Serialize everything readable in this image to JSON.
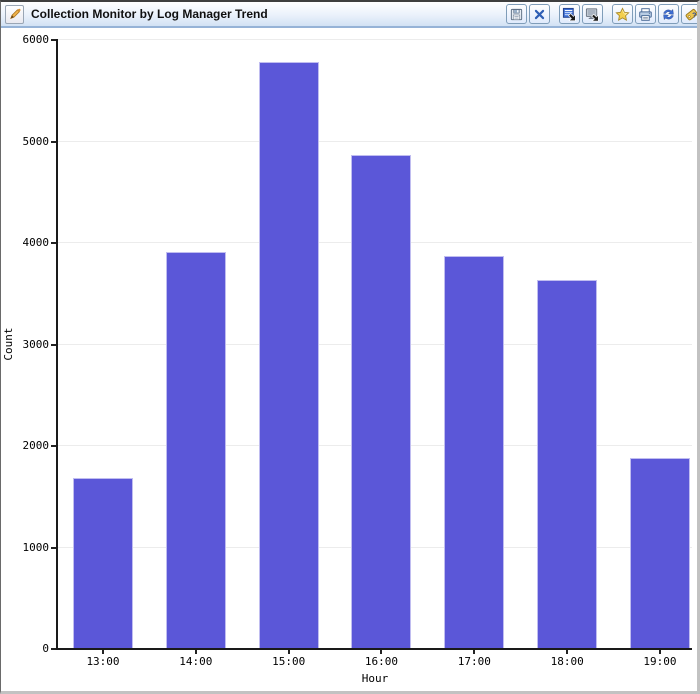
{
  "window": {
    "title": "Collection Monitor by Log Manager Trend",
    "titlebar_icon": "pencil-icon"
  },
  "toolbar": {
    "groups": [
      {
        "buttons": [
          {
            "name": "save-button",
            "icon": "save-icon"
          },
          {
            "name": "close-button",
            "icon": "close-icon"
          }
        ]
      },
      {
        "buttons": [
          {
            "name": "send-to-screen-button",
            "icon": "screen-list-arrow-icon"
          },
          {
            "name": "send-to-monitor-button",
            "icon": "monitor-arrow-icon"
          }
        ]
      },
      {
        "buttons": [
          {
            "name": "favorite-button",
            "icon": "star-icon"
          },
          {
            "name": "print-button",
            "icon": "print-icon"
          },
          {
            "name": "refresh-button",
            "icon": "refresh-icon"
          },
          {
            "name": "tag-button",
            "icon": "tag-icon"
          }
        ]
      }
    ]
  },
  "chart_data": {
    "type": "bar",
    "categories": [
      "13:00",
      "14:00",
      "15:00",
      "16:00",
      "17:00",
      "18:00",
      "19:00"
    ],
    "values": [
      1670,
      3900,
      5770,
      4860,
      3860,
      3630,
      1870
    ],
    "title": "",
    "xlabel": "Hour",
    "ylabel": "Count",
    "ylim": [
      0,
      6000
    ],
    "yticks": [
      0,
      1000,
      2000,
      3000,
      4000,
      5000,
      6000
    ],
    "grid": true,
    "legend": "none",
    "bar_color": "#5b57d8",
    "bar_border_color": "#c0bdf0",
    "gridline_color": "#ececec",
    "axis_color": "#1a1a1a"
  }
}
